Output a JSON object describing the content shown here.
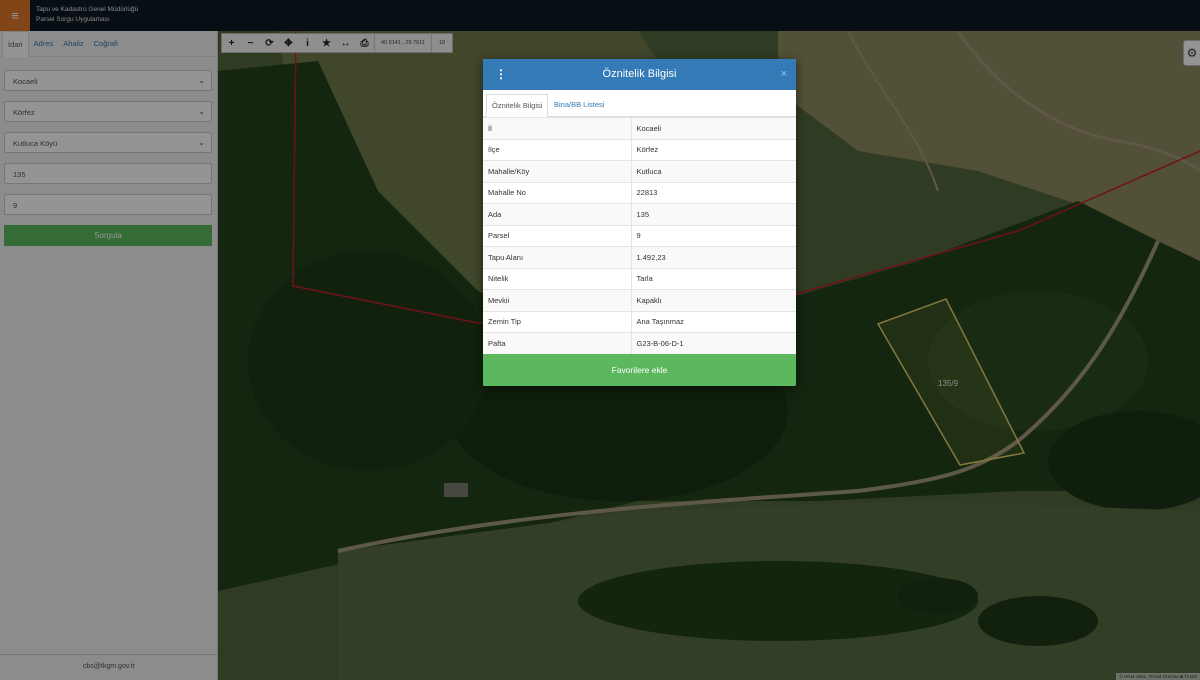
{
  "header": {
    "title_line1": "Tapu ve Kadastro Genel Müdürlüğü",
    "title_line2": "Parsel Sorgu Uygulaması",
    "menu_icon": "hamburger-icon"
  },
  "sidebar": {
    "tabs": [
      "İdari",
      "Adres",
      "Ahaliz",
      "Coğrafi"
    ],
    "active_tab": "İdari",
    "il": "Kocaeli",
    "ilce": "Körfez",
    "mahalle": "Kutluca Köyü",
    "ada": "135",
    "parsel": "9",
    "query_button": "Sorgula",
    "footer_email": "cbs@tkgm.gov.tr"
  },
  "toolbar": {
    "icons": [
      "zoom-in-icon",
      "zoom-out-icon",
      "refresh-icon",
      "locate-icon",
      "info-icon",
      "star-icon",
      "measure-icon",
      "print-icon"
    ],
    "coordinates": "40.9141 , 29.7611",
    "zoom_level": "18"
  },
  "map": {
    "parcel_label": "135/9",
    "attribution": "© HGM-Atlas, TKGM Ortofoto ■ TKGM",
    "parcel_outline_color": "#e4d06a",
    "boundary_color": "#c0202a"
  },
  "modal": {
    "title": "Öznitelik Bilgisi",
    "tabs": [
      "Öznitelik Bilgisi",
      "Bina/BB Listesi"
    ],
    "rows": [
      {
        "key": "İl",
        "value": "Kocaeli"
      },
      {
        "key": "İlçe",
        "value": "Körfez"
      },
      {
        "key": "Mahalle/Köy",
        "value": "Kutluca"
      },
      {
        "key": "Mahalle No",
        "value": "22813"
      },
      {
        "key": "Ada",
        "value": "135"
      },
      {
        "key": "Parsel",
        "value": "9"
      },
      {
        "key": "Tapu Alanı",
        "value": "1.492,23"
      },
      {
        "key": "Nitelik",
        "value": "Tarla"
      },
      {
        "key": "Mevkii",
        "value": "Kapaklı"
      },
      {
        "key": "Zemin Tip",
        "value": "Ana Taşınmaz"
      },
      {
        "key": "Pafta",
        "value": "G23-B-06-D-1"
      }
    ],
    "favorite_button": "Favorilere ekle",
    "accent": "#337ab7",
    "success": "#5cb85c"
  }
}
